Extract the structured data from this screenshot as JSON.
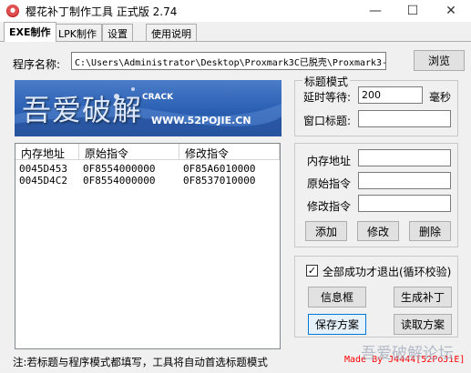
{
  "window": {
    "title": "樱花补丁制作工具 正式版 2.74",
    "controls": [
      "—",
      "☐",
      "✕"
    ]
  },
  "tabs": [
    {
      "label": "EXE制作",
      "active": true
    },
    {
      "label": "LPK制作",
      "active": false
    },
    {
      "label": "设置",
      "active": false
    },
    {
      "label": "使用说明",
      "active": false
    }
  ],
  "program": {
    "label": "程序名称:",
    "path": "C:\\Users\\Administrator\\Desktop\\Proxmark3C已脱壳\\Proxmark3-",
    "browse_label": "浏览"
  },
  "banner": {
    "big_text": "吾爱破解",
    "crack_text": "CRACK",
    "url": "WWW.52POJIE.CN"
  },
  "title_mode": {
    "legend": "标题模式",
    "delay_label": "延时等待:",
    "delay_value": "200",
    "delay_unit": "毫秒",
    "window_title_label": "窗口标题:",
    "window_title_value": ""
  },
  "table": {
    "headers": [
      "内存地址",
      "原始指令",
      "修改指令"
    ],
    "rows": [
      [
        "0045D453",
        "0F8554000000",
        "0F85A6010000"
      ],
      [
        "0045D4C2",
        "0F8554000000",
        "0F8537010000"
      ]
    ]
  },
  "edit": {
    "address_label": "内存地址",
    "original_label": "原始指令",
    "modified_label": "修改指令",
    "address_value": "",
    "original_value": "",
    "modified_value": "",
    "add_label": "添加",
    "modify_label": "修改",
    "delete_label": "删除"
  },
  "actions": {
    "checkbox_label": "全部成功才退出(循环校验)",
    "checkbox_checked": true,
    "info_box_label": "信息框",
    "generate_label": "生成补丁",
    "save_label": "保存方案",
    "load_label": "读取方案"
  },
  "status": {
    "note": "注:若标题与程序模式都填写，工具将自动首选标题模式",
    "credit": "Made By J4444[52PoJiE]",
    "watermark": "吾爱破解论坛"
  },
  "colors": {
    "banner_blue": "#2a5fb2",
    "credit_red": "#ff0000"
  }
}
